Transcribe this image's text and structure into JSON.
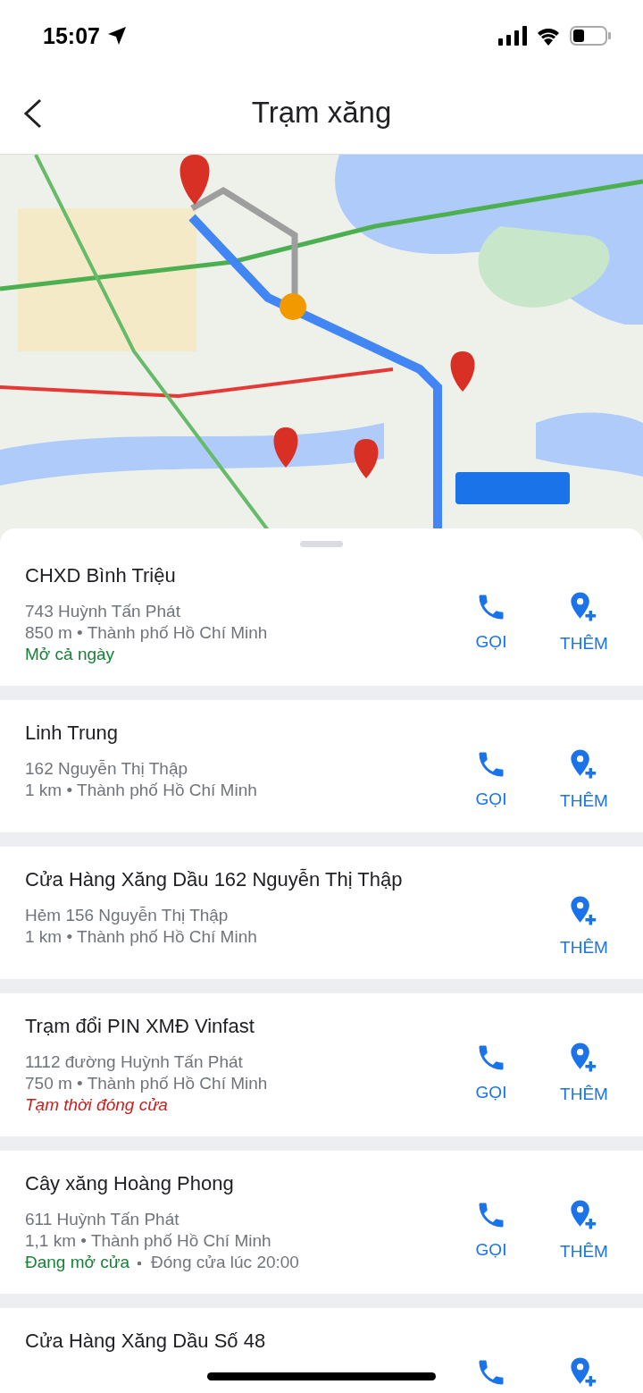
{
  "status_bar": {
    "time": "15:07"
  },
  "header": {
    "title": "Trạm xăng"
  },
  "places": [
    {
      "name": "CHXD Bình Triệu",
      "address": "743 Huỳnh Tấn Phát",
      "distance": "850 m • Thành phố Hồ Chí Minh",
      "status": {
        "text": "Mở cả ngày",
        "kind": "open"
      },
      "actions": [
        {
          "kind": "call",
          "label": "GỌI"
        },
        {
          "kind": "add",
          "label": "THÊM"
        }
      ]
    },
    {
      "name": "Linh Trung",
      "address": "162 Nguyễn Thị Thập",
      "distance": "1 km • Thành phố Hồ Chí Minh",
      "actions": [
        {
          "kind": "call",
          "label": "GỌI"
        },
        {
          "kind": "add",
          "label": "THÊM"
        }
      ]
    },
    {
      "name": "Cửa Hàng Xăng Dầu 162 Nguyễn Thị Thập",
      "address": "Hẻm 156 Nguyễn Thị Thập",
      "distance": "1 km • Thành phố Hồ Chí Minh",
      "actions": [
        {
          "kind": "add",
          "label": "THÊM"
        }
      ]
    },
    {
      "name": "Trạm đổi PIN XMĐ Vinfast",
      "address": "1112 đường Huỳnh Tấn Phát",
      "distance": "750 m • Thành phố Hồ Chí Minh",
      "status": {
        "text": "Tạm thời đóng cửa",
        "kind": "closed"
      },
      "actions": [
        {
          "kind": "call",
          "label": "GỌI"
        },
        {
          "kind": "add",
          "label": "THÊM"
        }
      ]
    },
    {
      "name": "Cây xăng Hoàng Phong",
      "address": "611 Huỳnh Tấn Phát",
      "distance": "1,1 km • Thành phố Hồ Chí Minh",
      "status": {
        "text": "Đang mở cửa",
        "kind": "open",
        "note": "Đóng cửa lúc 20:00"
      },
      "actions": [
        {
          "kind": "call",
          "label": "GỌI"
        },
        {
          "kind": "add",
          "label": "THÊM"
        }
      ]
    },
    {
      "name": "Cửa Hàng Xăng Dầu Số 48",
      "actions": [
        {
          "kind": "call"
        },
        {
          "kind": "add"
        }
      ]
    }
  ]
}
